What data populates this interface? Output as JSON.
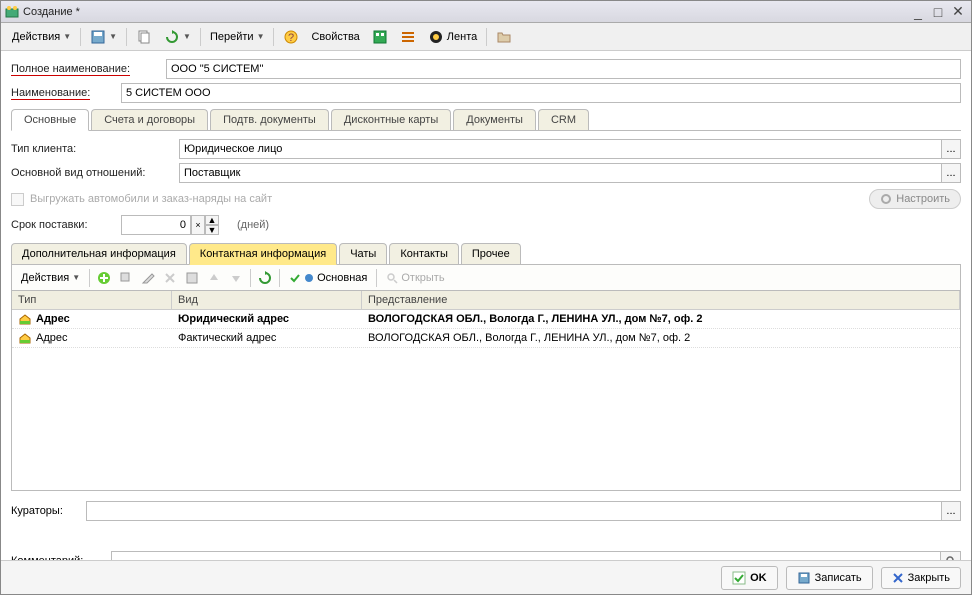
{
  "window": {
    "title": "Создание *"
  },
  "toolbar": {
    "actions": "Действия",
    "goto": "Перейти",
    "properties": "Свойства",
    "feed": "Лента"
  },
  "form": {
    "full_name_label": "Полное наименование:",
    "full_name_value": "ООО \"5 СИСТЕМ\"",
    "name_label": "Наименование:",
    "name_value": "5 СИСТЕМ ООО"
  },
  "tabs": {
    "main": "Основные",
    "accounts": "Счета и договоры",
    "docs": "Подтв. документы",
    "discount": "Дисконтные карты",
    "documents": "Документы",
    "crm": "CRM"
  },
  "fields": {
    "client_type_label": "Тип клиента:",
    "client_type_value": "Юридическое лицо",
    "relation_label": "Основной вид отношений:",
    "relation_value": "Поставщик",
    "upload_label": "Выгружать автомобили и заказ-наряды на сайт",
    "configure": "Настроить",
    "delivery_label": "Срок поставки:",
    "delivery_value": "0",
    "days": "(дней)"
  },
  "subtabs": {
    "extra": "Дополнительная информация",
    "contact": "Контактная информация",
    "chats": "Чаты",
    "contacts": "Контакты",
    "other": "Прочее"
  },
  "subtoolbar": {
    "actions": "Действия",
    "main": "Основная",
    "open": "Открыть"
  },
  "table": {
    "headers": {
      "type": "Тип",
      "kind": "Вид",
      "repr": "Представление"
    },
    "rows": [
      {
        "type": "Адрес",
        "kind": "Юридический адрес",
        "repr": "ВОЛОГОДСКАЯ ОБЛ., Вологда Г., ЛЕНИНА УЛ., дом №7, оф. 2"
      },
      {
        "type": "Адрес",
        "kind": "Фактический адрес",
        "repr": "ВОЛОГОДСКАЯ ОБЛ., Вологда Г., ЛЕНИНА УЛ., дом №7, оф. 2"
      }
    ]
  },
  "curators": {
    "label": "Кураторы:"
  },
  "comment": {
    "label": "Комментарий:"
  },
  "footer": {
    "ok": "OK",
    "save": "Записать",
    "close": "Закрыть"
  }
}
